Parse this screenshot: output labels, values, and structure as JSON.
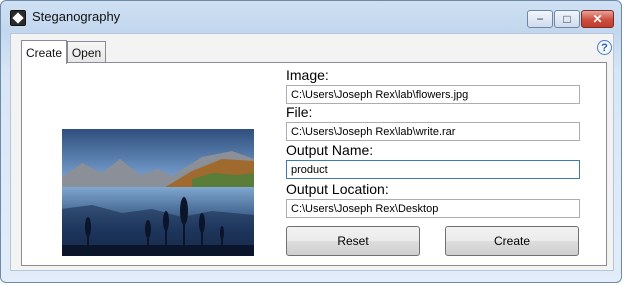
{
  "window": {
    "title": "Steganography"
  },
  "title_buttons": {
    "minimize": "−",
    "maximize": "□",
    "close": "✕"
  },
  "tabs": [
    {
      "label": "Create",
      "selected": true
    },
    {
      "label": "Open",
      "selected": false
    }
  ],
  "help": {
    "icon": "question-circle-icon",
    "glyph": "?"
  },
  "image_preview": {
    "description_icon": "landscape-image"
  },
  "form": {
    "image_label": "Image:",
    "image_value": "C:\\Users\\Joseph Rex\\lab\\flowers.jpg",
    "file_label": "File:",
    "file_value": "C:\\Users\\Joseph Rex\\lab\\write.rar",
    "output_name_label": "Output Name:",
    "output_name_value": "product",
    "output_location_label": "Output Location:",
    "output_location_value": "C:\\Users\\Joseph Rex\\Desktop"
  },
  "buttons": {
    "reset": "Reset",
    "create": "Create"
  },
  "colors": {
    "title_accent": "#c2d7ee",
    "close_button": "#cc4e3d",
    "focus_border": "#3d7bad"
  }
}
